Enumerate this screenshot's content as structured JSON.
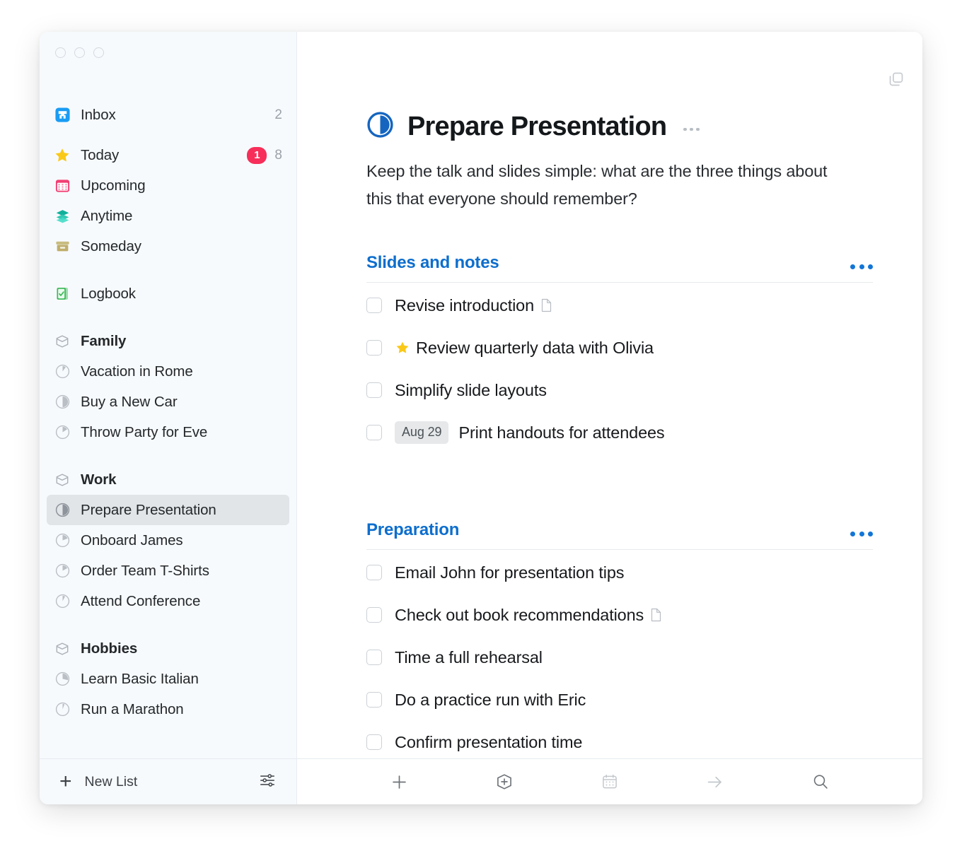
{
  "window": {
    "traffic_lights": [
      "close",
      "minimize",
      "zoom"
    ],
    "top_right_icon": "windows-overlap-icon"
  },
  "sidebar": {
    "items": [
      {
        "label": "Inbox",
        "icon": "inbox-tray-icon",
        "count": "2",
        "badge": null,
        "bold": false,
        "type": "smart"
      },
      {
        "label": "Today",
        "icon": "star-icon",
        "count": "8",
        "badge": "1",
        "bold": false,
        "type": "smart"
      },
      {
        "label": "Upcoming",
        "icon": "calendar-icon",
        "count": null,
        "badge": null,
        "bold": false,
        "type": "smart"
      },
      {
        "label": "Anytime",
        "icon": "layers-icon",
        "count": null,
        "badge": null,
        "bold": false,
        "type": "smart"
      },
      {
        "label": "Someday",
        "icon": "archive-box-icon",
        "count": null,
        "badge": null,
        "bold": false,
        "type": "smart"
      },
      {
        "label": "Logbook",
        "icon": "logbook-icon",
        "count": null,
        "badge": null,
        "bold": false,
        "type": "smart"
      },
      {
        "label": "Family",
        "icon": "area-icon",
        "count": null,
        "badge": null,
        "bold": true,
        "type": "area"
      },
      {
        "label": "Vacation in Rome",
        "icon": "progress-pie-icon",
        "progress": 10,
        "bold": false,
        "type": "project"
      },
      {
        "label": "Buy a New Car",
        "icon": "progress-pie-icon",
        "progress": 50,
        "bold": false,
        "type": "project"
      },
      {
        "label": "Throw Party for Eve",
        "icon": "progress-pie-icon",
        "progress": 18,
        "bold": false,
        "type": "project"
      },
      {
        "label": "Work",
        "icon": "area-icon",
        "count": null,
        "badge": null,
        "bold": true,
        "type": "area"
      },
      {
        "label": "Prepare Presentation",
        "icon": "progress-pie-icon",
        "progress": 50,
        "bold": false,
        "type": "project",
        "selected": true
      },
      {
        "label": "Onboard James",
        "icon": "progress-pie-icon",
        "progress": 22,
        "bold": false,
        "type": "project"
      },
      {
        "label": "Order Team T-Shirts",
        "icon": "progress-pie-icon",
        "progress": 20,
        "bold": false,
        "type": "project"
      },
      {
        "label": "Attend Conference",
        "icon": "progress-pie-icon",
        "progress": 8,
        "bold": false,
        "type": "project"
      },
      {
        "label": "Hobbies",
        "icon": "area-icon",
        "count": null,
        "badge": null,
        "bold": true,
        "type": "area"
      },
      {
        "label": "Learn Basic Italian",
        "icon": "progress-pie-icon",
        "progress": 35,
        "bold": false,
        "type": "project"
      },
      {
        "label": "Run a Marathon",
        "icon": "progress-pie-icon",
        "progress": 6,
        "bold": false,
        "type": "project"
      }
    ],
    "footer": {
      "new_list_label": "New List",
      "plus_symbol": "+",
      "settings_icon": "sliders-icon"
    }
  },
  "main": {
    "title": "Prepare Presentation",
    "title_icon": "progress-pie-icon-blue",
    "title_progress": 50,
    "title_more_icon": "more-options-icon",
    "note": "Keep the talk and slides simple: what are the three things about this that everyone should remember?",
    "sections": [
      {
        "heading": "Slides and notes",
        "more_icon": "section-more-icon",
        "todos": [
          {
            "text": "Revise introduction",
            "checked": false,
            "star": false,
            "date": null,
            "has_note": true
          },
          {
            "text": "Review quarterly data with Olivia",
            "checked": false,
            "star": true,
            "date": null,
            "has_note": false
          },
          {
            "text": "Simplify slide layouts",
            "checked": false,
            "star": false,
            "date": null,
            "has_note": false
          },
          {
            "text": "Print handouts for attendees",
            "checked": false,
            "star": false,
            "date": "Aug 29",
            "has_note": false
          }
        ]
      },
      {
        "heading": "Preparation",
        "more_icon": "section-more-icon",
        "todos": [
          {
            "text": "Email John for presentation tips",
            "checked": false,
            "star": false,
            "date": null,
            "has_note": false
          },
          {
            "text": "Check out book recommendations",
            "checked": false,
            "star": false,
            "date": null,
            "has_note": true
          },
          {
            "text": "Time a full rehearsal",
            "checked": false,
            "star": false,
            "date": null,
            "has_note": false
          },
          {
            "text": "Do a practice run with Eric",
            "checked": false,
            "star": false,
            "date": null,
            "has_note": false
          },
          {
            "text": "Confirm presentation time",
            "checked": false,
            "star": false,
            "date": null,
            "has_note": false
          }
        ]
      }
    ],
    "toolbar": [
      {
        "icon": "plus-icon",
        "name": "new-todo-button"
      },
      {
        "icon": "new-project-icon",
        "name": "new-project-button"
      },
      {
        "icon": "calendar-icon",
        "name": "when-button"
      },
      {
        "icon": "arrow-right-icon",
        "name": "move-button"
      },
      {
        "icon": "search-icon",
        "name": "search-button"
      }
    ]
  },
  "colors": {
    "accent_blue": "#1275d6",
    "badge_red": "#f72e59",
    "star_yellow": "#fac918",
    "sidebar_bg": "#f7fafd",
    "selected_bg": "#e2e5e8"
  }
}
